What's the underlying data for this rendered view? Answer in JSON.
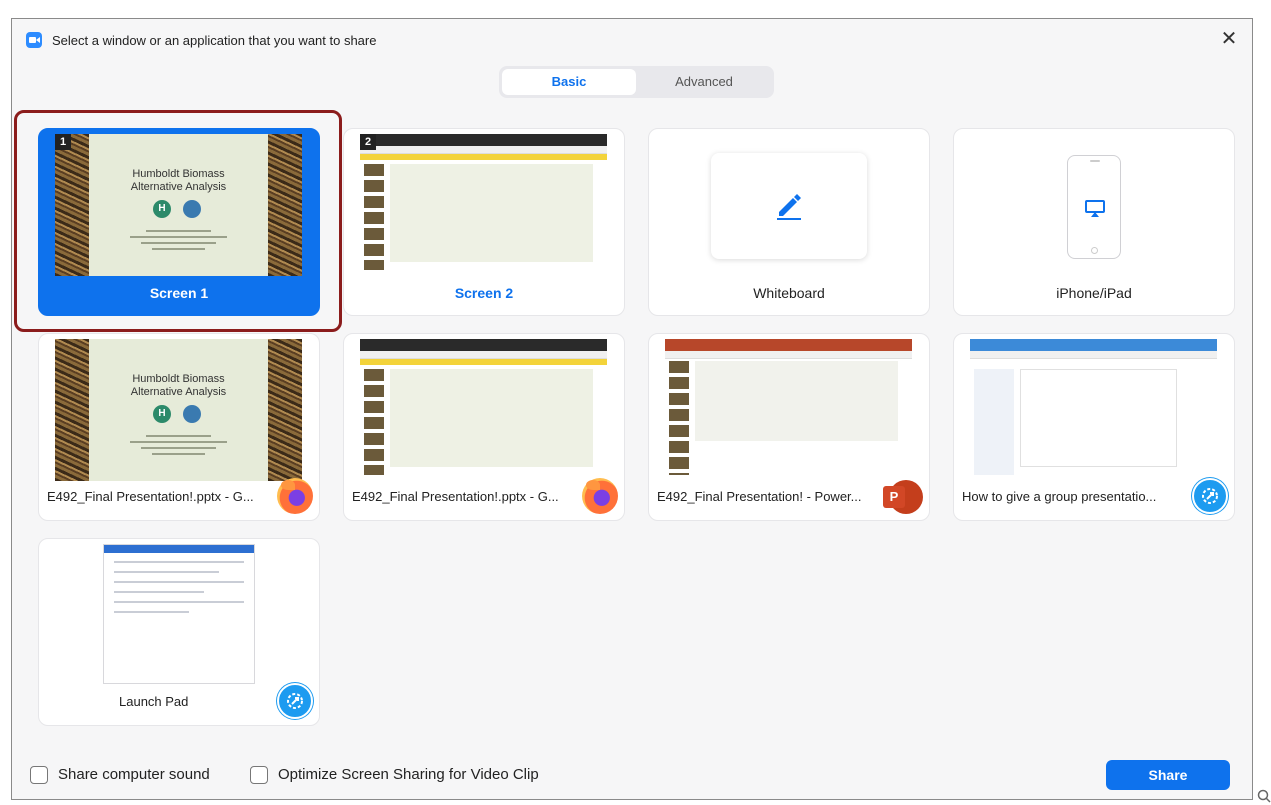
{
  "window": {
    "title": "Select a window or an application that you want to share",
    "close_glyph": "✕"
  },
  "tabs": {
    "basic": "Basic",
    "advanced": "Advanced"
  },
  "slide": {
    "title_line1": "Humboldt Biomass",
    "title_line2": "Alternative Analysis",
    "badge_h": "H"
  },
  "cards": {
    "screen1": {
      "label": "Screen 1",
      "number": "1"
    },
    "screen2": {
      "label": "Screen 2",
      "number": "2"
    },
    "whiteboard": {
      "label": "Whiteboard",
      "icon": "pencil-icon"
    },
    "iphone": {
      "label": "iPhone/iPad",
      "icon": "airplay-icon"
    },
    "firefox1": {
      "label": "E492_Final Presentation!.pptx - G...",
      "app_icon": "firefox-icon"
    },
    "firefox2": {
      "label": "E492_Final Presentation!.pptx - G...",
      "app_icon": "firefox-icon"
    },
    "powerpoint": {
      "label": "E492_Final Presentation! - Power...",
      "app_icon": "powerpoint-icon",
      "app_letter": "P"
    },
    "howto": {
      "label": "How to give a group presentatio...",
      "app_icon": "snipping-tool-icon"
    },
    "launchpad": {
      "label": "Launch Pad",
      "app_icon": "snipping-tool-icon"
    }
  },
  "footer": {
    "share_sound": "Share computer sound",
    "optimize": "Optimize Screen Sharing for Video Clip",
    "share_button": "Share"
  },
  "colors": {
    "accent": "#0e72ed",
    "selection_outline": "#8b1c1c"
  }
}
